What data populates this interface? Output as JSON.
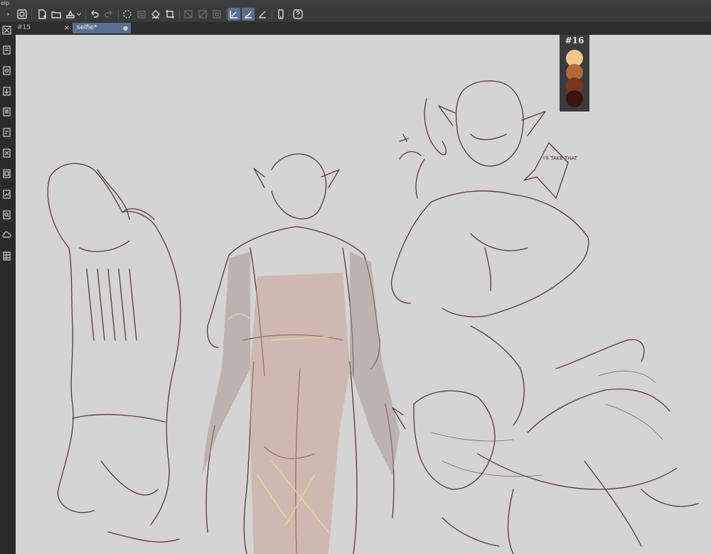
{
  "menubar": {
    "label": "elp"
  },
  "tabs": [
    {
      "label": "#15",
      "close": "×",
      "active": false
    },
    {
      "label": "selfie*",
      "close": "●",
      "active": true
    }
  ],
  "palette": {
    "label": "#16",
    "colors": [
      "#f0c88a",
      "#b06a3a",
      "#7a3422",
      "#3a1410"
    ]
  },
  "speech_bubble": {
    "text": "I'll TAKE THAT"
  }
}
